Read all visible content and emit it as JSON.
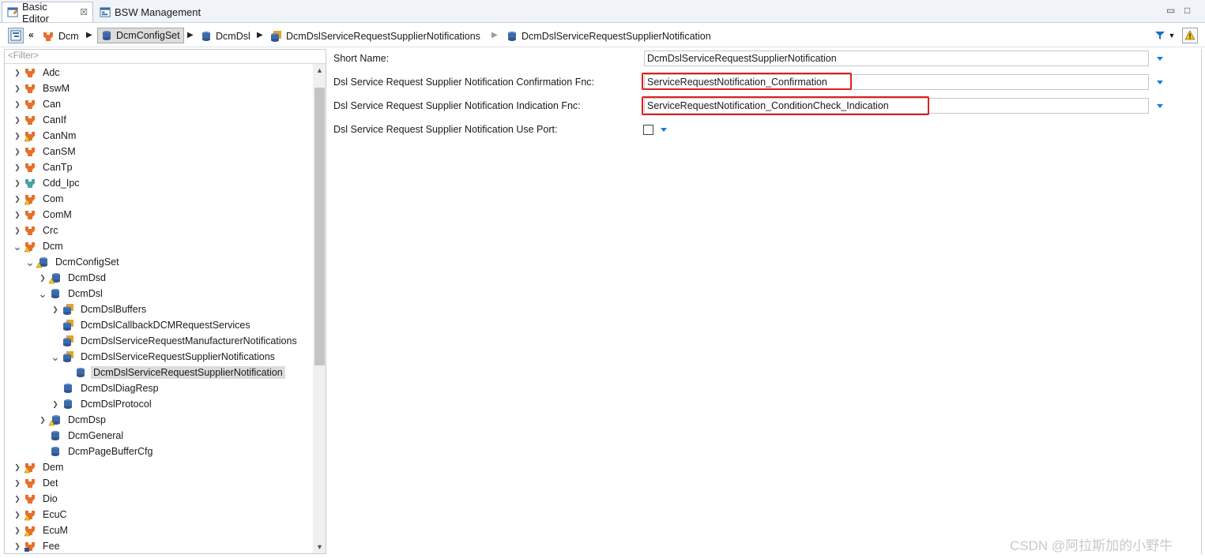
{
  "tabs": {
    "basic_editor": "Basic Editor",
    "bsw_management": "BSW Management",
    "close_glyph": "☒"
  },
  "window": {
    "minimize": "▭",
    "maximize": "□"
  },
  "breadcrumb": {
    "items": [
      "Dcm",
      "DcmConfigSet",
      "DcmDsl",
      "DcmDslServiceRequestSupplierNotifications",
      "DcmDslServiceRequestSupplierNotification"
    ]
  },
  "tree": {
    "filter_placeholder": "<Filter>",
    "items": [
      {
        "label": "Adc"
      },
      {
        "label": "BswM"
      },
      {
        "label": "Can"
      },
      {
        "label": "CanIf"
      },
      {
        "label": "CanNm"
      },
      {
        "label": "CanSM"
      },
      {
        "label": "CanTp"
      },
      {
        "label": "Cdd_Ipc"
      },
      {
        "label": "Com"
      },
      {
        "label": "ComM"
      },
      {
        "label": "Crc"
      },
      {
        "label": "Dcm"
      },
      {
        "label": "DcmConfigSet"
      },
      {
        "label": "DcmDsd"
      },
      {
        "label": "DcmDsl"
      },
      {
        "label": "DcmDslBuffers"
      },
      {
        "label": "DcmDslCallbackDCMRequestServices"
      },
      {
        "label": "DcmDslServiceRequestManufacturerNotifications"
      },
      {
        "label": "DcmDslServiceRequestSupplierNotifications"
      },
      {
        "label": "DcmDslServiceRequestSupplierNotification"
      },
      {
        "label": "DcmDslDiagResp"
      },
      {
        "label": "DcmDslProtocol"
      },
      {
        "label": "DcmDsp"
      },
      {
        "label": "DcmGeneral"
      },
      {
        "label": "DcmPageBufferCfg"
      },
      {
        "label": "Dem"
      },
      {
        "label": "Det"
      },
      {
        "label": "Dio"
      },
      {
        "label": "EcuC"
      },
      {
        "label": "EcuM"
      },
      {
        "label": "Fee"
      }
    ]
  },
  "form": {
    "short_name": {
      "label": "Short Name:",
      "value": "DcmDslServiceRequestSupplierNotification"
    },
    "confirmation_fnc": {
      "label": "Dsl Service Request Supplier Notification Confirmation Fnc:",
      "value": "ServiceRequestNotification_Confirmation"
    },
    "indication_fnc": {
      "label": "Dsl Service Request Supplier Notification Indication Fnc:",
      "value": "ServiceRequestNotification_ConditionCheck_Indication"
    },
    "use_port": {
      "label": "Dsl Service Request Supplier Notification Use Port:",
      "checked": false
    }
  },
  "watermark": "CSDN @阿拉斯加的小野牛",
  "colors": {
    "highlight": "#e0201c",
    "accent": "#1a7bd0",
    "module_icon": "#e8702a"
  }
}
